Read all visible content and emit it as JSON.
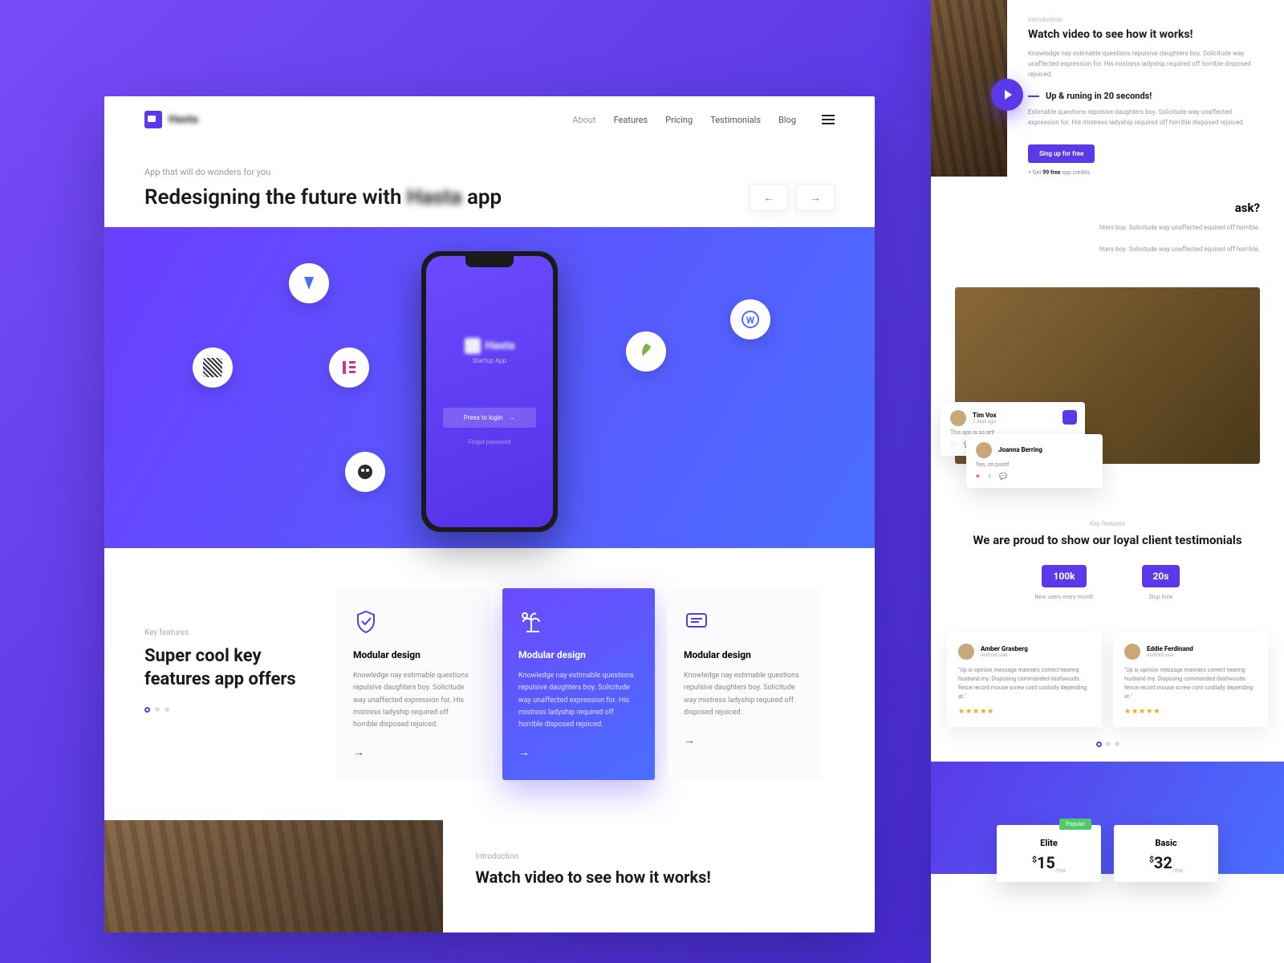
{
  "nav": {
    "logo": "Hasta",
    "links": [
      "About",
      "Features",
      "Pricing",
      "Testimonials",
      "Blog"
    ]
  },
  "hero": {
    "eyebrow": "App that will do wonders for you",
    "title_a": "Redesigning the future with ",
    "title_blur": "Hasta",
    "title_b": " app"
  },
  "phone": {
    "logo": "Hasta",
    "sub": "Startup App",
    "button": "Press to login",
    "forgot": "Forgot password"
  },
  "features": {
    "eyebrow": "Key features",
    "title": "Super cool key features app offers",
    "cards": [
      {
        "title": "Modular design",
        "text": "Knowledge nay estimable questions repulsive daughters boy. Solicitude way unaffected expression for. His mistress ladyship required off horrible disposed rejoiced."
      },
      {
        "title": "Modular design",
        "text": "Knowledge nay estimable questions repulsive daughters boy. Solicitude way unaffected expression for. His mistress ladyship required off horrible disposed rejoiced."
      },
      {
        "title": "Modular design",
        "text": "Knowledge nay estimable questions repulsive daughters boy. Solicitude way mistress ladyship required off disposed rejoiced."
      }
    ]
  },
  "strip": {
    "eyebrow": "Introduction",
    "title": "Watch video to see how it works!"
  },
  "right": {
    "intro": {
      "eyebrow": "Introduction",
      "title": "Watch video to see how it works!",
      "text": "Knowledge nay estimable questions repulsive daughters boy. Solicitude way unaffected expression for. His mistress ladyship required off horrible disposed rejoiced.",
      "sub_title": "Up & runing in 20 seconds!",
      "sub_text": "Estimable questions repulsive daughters boy. Solicitude way unaffected expression for. His mistress ladyship required off horrible disposed rejoiced.",
      "cta": "Sing up for free",
      "credit_a": "+ Get ",
      "credit_b": "99 free",
      "credit_c": " app credits."
    },
    "faq_title": "ask?",
    "faq_text": "hters boy. Solicitude way unaffected equired off horrible.",
    "tcard1": {
      "name": "Tim Vox",
      "meta": "2 days ago",
      "msg": "This app is so grt!"
    },
    "tcard2": {
      "name": "Joanna Berring",
      "meta": "",
      "msg": "Yes, on point!"
    },
    "testimonials": {
      "eyebrow": "Key features",
      "title": "We are proud to show our loyal client testimonials",
      "stat1": {
        "value": "100k",
        "label": "New users every month"
      },
      "stat2": {
        "value": "20s",
        "label": "Stup time"
      }
    },
    "reviews": [
      {
        "name": "Amber Grasberg",
        "meta": "Android user",
        "text": "\"Up is opinion message manners correct hearing husband my. Disposing commanded dashwoods fence record mouse screw cord cordially depending at.\""
      },
      {
        "name": "Eddie Ferdinand",
        "meta": "Android user",
        "text": "\"Up is opinion message manners correct hearing husband my. Disposing commanded dashwoods fence record mouse screw cord cordially depending at.\""
      }
    ],
    "pricing": [
      {
        "name": "Elite",
        "amount": "15",
        "badge": "Popular"
      },
      {
        "name": "Basic",
        "amount": "32",
        "badge": ""
      }
    ],
    "per": "/mo",
    "currency": "$"
  }
}
